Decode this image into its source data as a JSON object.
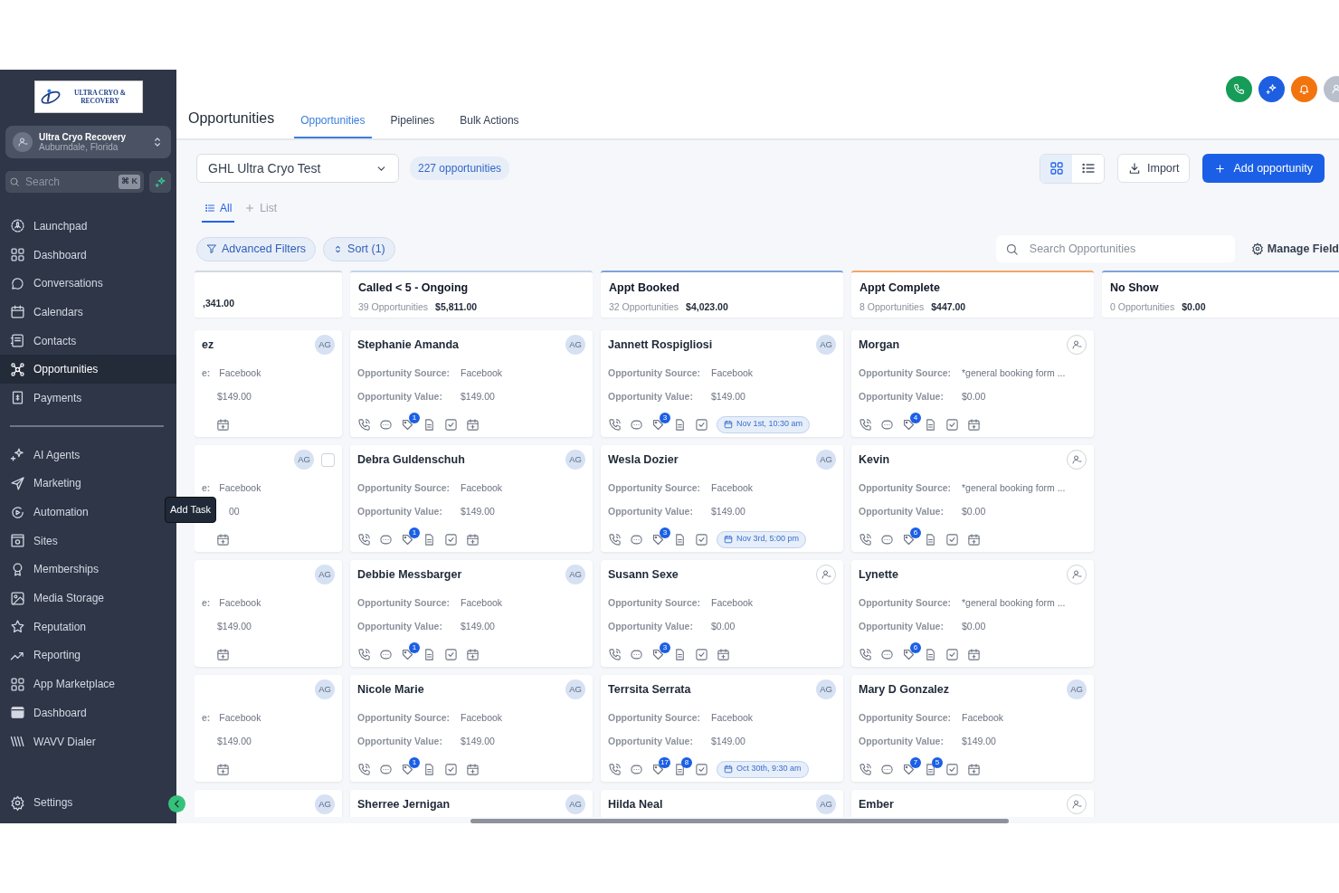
{
  "sidebar": {
    "logo_text": "ULTRA CRYO & RECOVERY",
    "account": {
      "name": "Ultra Cryo Recovery",
      "location": "Auburndale, Florida"
    },
    "search": {
      "placeholder": "Search",
      "shortcut": "⌘ K"
    },
    "groups": [
      {
        "items": [
          {
            "label": "Launchpad",
            "selected": false
          },
          {
            "label": "Dashboard",
            "selected": false
          },
          {
            "label": "Conversations",
            "selected": false
          },
          {
            "label": "Calendars",
            "selected": false
          },
          {
            "label": "Contacts",
            "selected": false
          },
          {
            "label": "Opportunities",
            "selected": true
          },
          {
            "label": "Payments",
            "selected": false
          }
        ]
      },
      {
        "items": [
          {
            "label": "AI Agents",
            "selected": false
          },
          {
            "label": "Marketing",
            "selected": false
          },
          {
            "label": "Automation",
            "selected": false
          },
          {
            "label": "Sites",
            "selected": false
          },
          {
            "label": "Memberships",
            "selected": false
          },
          {
            "label": "Media Storage",
            "selected": false
          },
          {
            "label": "Reputation",
            "selected": false
          },
          {
            "label": "Reporting",
            "selected": false
          },
          {
            "label": "App Marketplace",
            "selected": false
          },
          {
            "label": "Dashboard",
            "selected": false
          },
          {
            "label": "WAVV Dialer",
            "selected": false
          }
        ]
      }
    ],
    "settings": {
      "label": "Settings"
    }
  },
  "header": {
    "title": "Opportunities",
    "tabs": [
      {
        "label": "Opportunities",
        "selected": true
      },
      {
        "label": "Pipelines",
        "selected": false
      },
      {
        "label": "Bulk Actions",
        "selected": false
      }
    ]
  },
  "toolbar": {
    "pipeline": "GHL Ultra Cryo Test",
    "count": "227 opportunities",
    "layout_toggle": [
      {
        "kind": "grid",
        "selected": true
      },
      {
        "kind": "list",
        "selected": false
      }
    ],
    "import_label": "Import",
    "add_label": "Add opportunity"
  },
  "views": [
    {
      "kind": "list",
      "label": "All",
      "selected": true
    },
    {
      "kind": "add",
      "label": "List",
      "selected": false
    }
  ],
  "filters": {
    "advanced_label": "Advanced Filters",
    "sort_label": "Sort (1)",
    "search_placeholder": "Search Opportunities",
    "manage_label": "Manage Field"
  },
  "tooltip": "Add Task",
  "columns": [
    {
      "value": ",341.00",
      "color": "#d4d8df",
      "cards": [
        {
          "name": "ez",
          "avatar": {
            "kind": "initials",
            "text": "AG"
          },
          "source_label": "e:",
          "source": "Facebook",
          "value": "$149.00"
        },
        {
          "avatar": {
            "kind": "initials",
            "text": "AG"
          },
          "checkbox": {
            "checked": false
          },
          "source_label": "e:",
          "source": "Facebook",
          "value": "00"
        },
        {
          "avatar": {
            "kind": "initials",
            "text": "AG"
          },
          "source_label": "e:",
          "source": "Facebook",
          "value": "$149.00"
        },
        {
          "avatar": {
            "kind": "initials",
            "text": "AG"
          },
          "source_label": "e:",
          "source": "Facebook",
          "value": "$149.00"
        },
        {
          "avatar": {
            "kind": "initials",
            "text": "AG"
          }
        }
      ]
    },
    {
      "title": "Called < 5 - Ongoing",
      "count": "39 Opportunities",
      "value": "$5,811.00",
      "color": "#c5d3ea",
      "cards": [
        {
          "name": "Stephanie Amanda",
          "avatar": {
            "kind": "initials",
            "text": "AG"
          },
          "source_label": "Opportunity Source:",
          "source": "Facebook",
          "value_label": "Opportunity Value:",
          "value": "$149.00",
          "tag_count": "1"
        },
        {
          "name": "Debra Guldenschuh",
          "avatar": {
            "kind": "initials",
            "text": "AG"
          },
          "source_label": "Opportunity Source:",
          "source": "Facebook",
          "value_label": "Opportunity Value:",
          "value": "$149.00",
          "tag_count": "1"
        },
        {
          "name": "Debbie Messbarger",
          "avatar": {
            "kind": "initials",
            "text": "AG"
          },
          "source_label": "Opportunity Source:",
          "source": "Facebook",
          "value_label": "Opportunity Value:",
          "value": "$149.00",
          "tag_count": "1"
        },
        {
          "name": "Nicole Marie",
          "avatar": {
            "kind": "initials",
            "text": "AG"
          },
          "source_label": "Opportunity Source:",
          "source": "Facebook",
          "value_label": "Opportunity Value:",
          "value": "$149.00",
          "tag_count": "1"
        },
        {
          "name": "Sherree Jernigan",
          "avatar": {
            "kind": "initials",
            "text": "AG"
          }
        }
      ]
    },
    {
      "title": "Appt Booked",
      "count": "32 Opportunities",
      "value": "$4,023.00",
      "color": "#7ea2dc",
      "cards": [
        {
          "name": "Jannett Rospigliosi",
          "avatar": {
            "kind": "initials",
            "text": "AG"
          },
          "source_label": "Opportunity Source:",
          "source": "Facebook",
          "value_label": "Opportunity Value:",
          "value": "$149.00",
          "tag_count": "3",
          "appointment": "Nov 1st, 10:30 am"
        },
        {
          "name": "Wesla Dozier",
          "avatar": {
            "kind": "initials",
            "text": "AG"
          },
          "source_label": "Opportunity Source:",
          "source": "Facebook",
          "value_label": "Opportunity Value:",
          "value": "$149.00",
          "tag_count": "3",
          "appointment": "Nov 3rd, 5:00 pm"
        },
        {
          "name": "Susann Sexe",
          "avatar": {
            "kind": "unassigned"
          },
          "source_label": "Opportunity Source:",
          "source": "Facebook",
          "value_label": "Opportunity Value:",
          "value": "$0.00",
          "tag_count": "3"
        },
        {
          "name": "Terrsita Serrata",
          "avatar": {
            "kind": "initials",
            "text": "AG"
          },
          "source_label": "Opportunity Source:",
          "source": "Facebook",
          "value_label": "Opportunity Value:",
          "value": "$149.00",
          "tag_count": "17",
          "note_count": "8",
          "appointment": "Oct 30th, 9:30 am"
        },
        {
          "name": "Hilda Neal",
          "avatar": {
            "kind": "initials",
            "text": "AG"
          }
        }
      ]
    },
    {
      "title": "Appt Complete",
      "count": "8 Opportunities",
      "value": "$447.00",
      "color": "#f0a868",
      "cards": [
        {
          "name": "Morgan",
          "avatar": {
            "kind": "unassigned"
          },
          "source_label": "Opportunity Source:",
          "source": "*general booking form ...",
          "value_label": "Opportunity Value:",
          "value": "$0.00",
          "tag_count": "4"
        },
        {
          "name": "Kevin",
          "avatar": {
            "kind": "unassigned"
          },
          "source_label": "Opportunity Source:",
          "source": "*general booking form ...",
          "value_label": "Opportunity Value:",
          "value": "$0.00",
          "tag_count": "6"
        },
        {
          "name": "Lynette",
          "avatar": {
            "kind": "unassigned"
          },
          "source_label": "Opportunity Source:",
          "source": "*general booking form ...",
          "value_label": "Opportunity Value:",
          "value": "$0.00",
          "tag_count": "6"
        },
        {
          "name": "Mary D Gonzalez",
          "avatar": {
            "kind": "initials",
            "text": "AG"
          },
          "source_label": "Opportunity Source:",
          "source": "Facebook",
          "value_label": "Opportunity Value:",
          "value": "$149.00",
          "tag_count": "7",
          "note_count": "5"
        },
        {
          "name": "Ember",
          "avatar": {
            "kind": "unassigned"
          }
        }
      ]
    },
    {
      "title": "No Show",
      "count": "0 Opportunities",
      "value": "$0.00",
      "color": "#7ea2dc"
    }
  ]
}
